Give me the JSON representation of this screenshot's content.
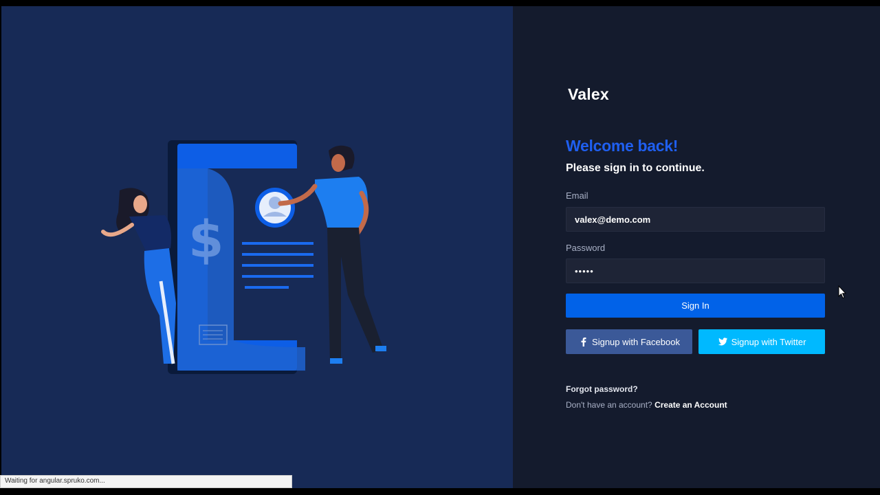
{
  "brand": {
    "name": "Valex"
  },
  "login": {
    "heading": "Welcome back!",
    "subheading": "Please sign in to continue.",
    "email_label": "Email",
    "email_value": "valex@demo.com",
    "password_label": "Password",
    "password_value": "•••••",
    "signin_label": "Sign In",
    "facebook_label": "Signup with Facebook",
    "twitter_label": "Signup with Twitter",
    "forgot_label": "Forgot password?",
    "no_account_text": "Don't have an account?",
    "create_account_label": "Create an Account"
  },
  "browser": {
    "status_text": "Waiting for angular.spruko.com..."
  },
  "illustration": {
    "icon": "payment-people-illustration"
  },
  "colors": {
    "left_bg": "#172a56",
    "right_bg": "#141b2d",
    "accent": "#0162e8",
    "facebook": "#3b5998",
    "twitter": "#00b9ff",
    "welcome": "#1f5ff0"
  }
}
